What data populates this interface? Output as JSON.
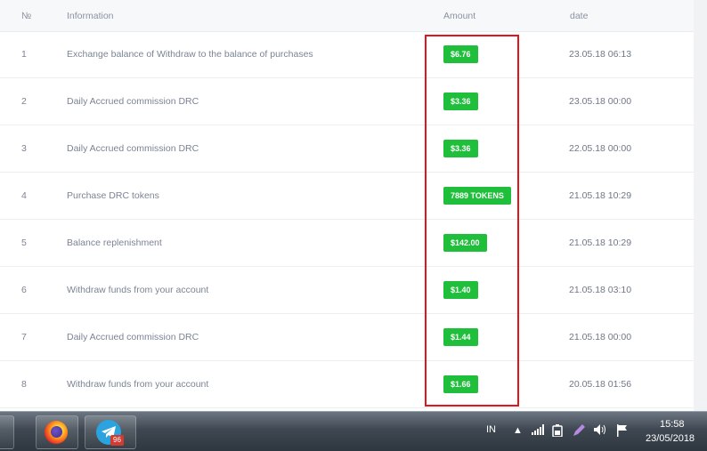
{
  "table": {
    "headers": {
      "num": "№",
      "info": "Information",
      "amount": "Amount",
      "date": "date"
    },
    "rows": [
      {
        "num": "1",
        "info": "Exchange balance of Withdraw to the balance of purchases",
        "amount": "$6.76",
        "date": "23.05.18 06:13"
      },
      {
        "num": "2",
        "info": "Daily Accrued commission DRC",
        "amount": "$3.36",
        "date": "23.05.18 00:00"
      },
      {
        "num": "3",
        "info": "Daily Accrued commission DRC",
        "amount": "$3.36",
        "date": "22.05.18 00:00"
      },
      {
        "num": "4",
        "info": "Purchase DRC tokens",
        "amount": "7889 TOKENS",
        "date": "21.05.18 10:29"
      },
      {
        "num": "5",
        "info": "Balance replenishment",
        "amount": "$142.00",
        "date": "21.05.18 10:29"
      },
      {
        "num": "6",
        "info": "Withdraw funds from your account",
        "amount": "$1.40",
        "date": "21.05.18 03:10"
      },
      {
        "num": "7",
        "info": "Daily Accrued commission DRC",
        "amount": "$1.44",
        "date": "21.05.18 00:00"
      },
      {
        "num": "8",
        "info": "Withdraw funds from your account",
        "amount": "$1.66",
        "date": "20.05.18 01:56"
      }
    ]
  },
  "colors": {
    "badge": "#1fbe3b",
    "highlight": "#e3151c"
  },
  "taskbar": {
    "telegram_badge": "96",
    "language": "IN",
    "time": "15:58",
    "date": "23/05/2018"
  }
}
